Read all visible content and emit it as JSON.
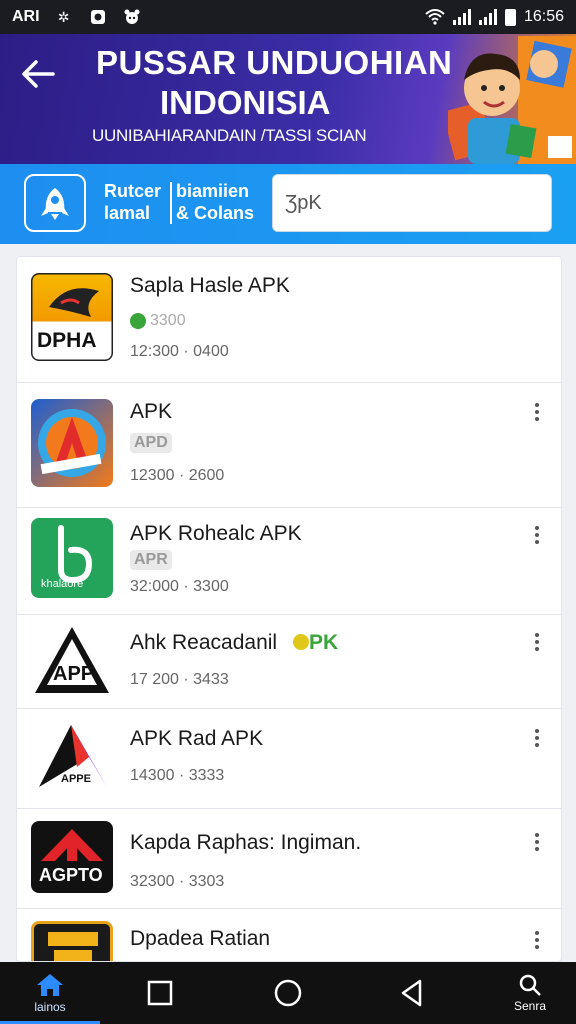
{
  "status_bar": {
    "carrier": "ARI",
    "time": "16:56",
    "icons": [
      "puzzle-icon",
      "camera-icon",
      "animal-icon",
      "wifi-icon",
      "signal-icon",
      "signal-icon",
      "battery-icon"
    ]
  },
  "header": {
    "back_icon": "arrow-left-icon",
    "title_line1": "PUSSAR UNDUOHIAN",
    "title_line2": "INDONISIA",
    "subtitle": "UUNIBAHIARANDAIN /TASSI SCIAN",
    "colors": {
      "start": "#2c1d86",
      "end": "#f08a1a"
    }
  },
  "search_strip": {
    "rocket_icon": "rocket-icon",
    "filter_a_line1": "Rutcer",
    "filter_a_line2": "lamal",
    "filter_b_line1": "biamiien",
    "filter_b_line2": "& Colans",
    "search_value": "ƷpK",
    "color": "#1e8ef0"
  },
  "apps": [
    {
      "name": "Sapla Hasle APK",
      "badge": "3300",
      "meta": "12:300 · 0400",
      "icon_text": "DPHA",
      "has_menu": false
    },
    {
      "name": "APK",
      "badge": "APD",
      "meta": "12300 · 2600",
      "icon_text": "",
      "has_menu": true
    },
    {
      "name": "APK Rohealc APK",
      "badge": "APR",
      "meta": "32:000 · 3300",
      "icon_text": "khalaore",
      "has_menu": true
    },
    {
      "name": "Ahk Reacadanil",
      "name_suffix": "PK",
      "meta": "17 200 · 3433",
      "icon_text": "APP",
      "has_menu": true
    },
    {
      "name": "APK Rad APK",
      "meta": "14300 · 3333",
      "icon_text": "APPE",
      "has_menu": true
    },
    {
      "name": "Kapda Raphas: Ingiman.",
      "meta": "32300 · 3303",
      "icon_text": "AGPTO",
      "has_menu": true
    },
    {
      "name": "Dpadea Ratian",
      "meta": "",
      "icon_text": "",
      "has_menu": true
    }
  ],
  "nav_bar": {
    "home_label": "lainos",
    "search_label": "Senra",
    "icons": [
      "home-icon",
      "square-icon",
      "circle-icon",
      "back-triangle-icon",
      "search-icon"
    ]
  }
}
